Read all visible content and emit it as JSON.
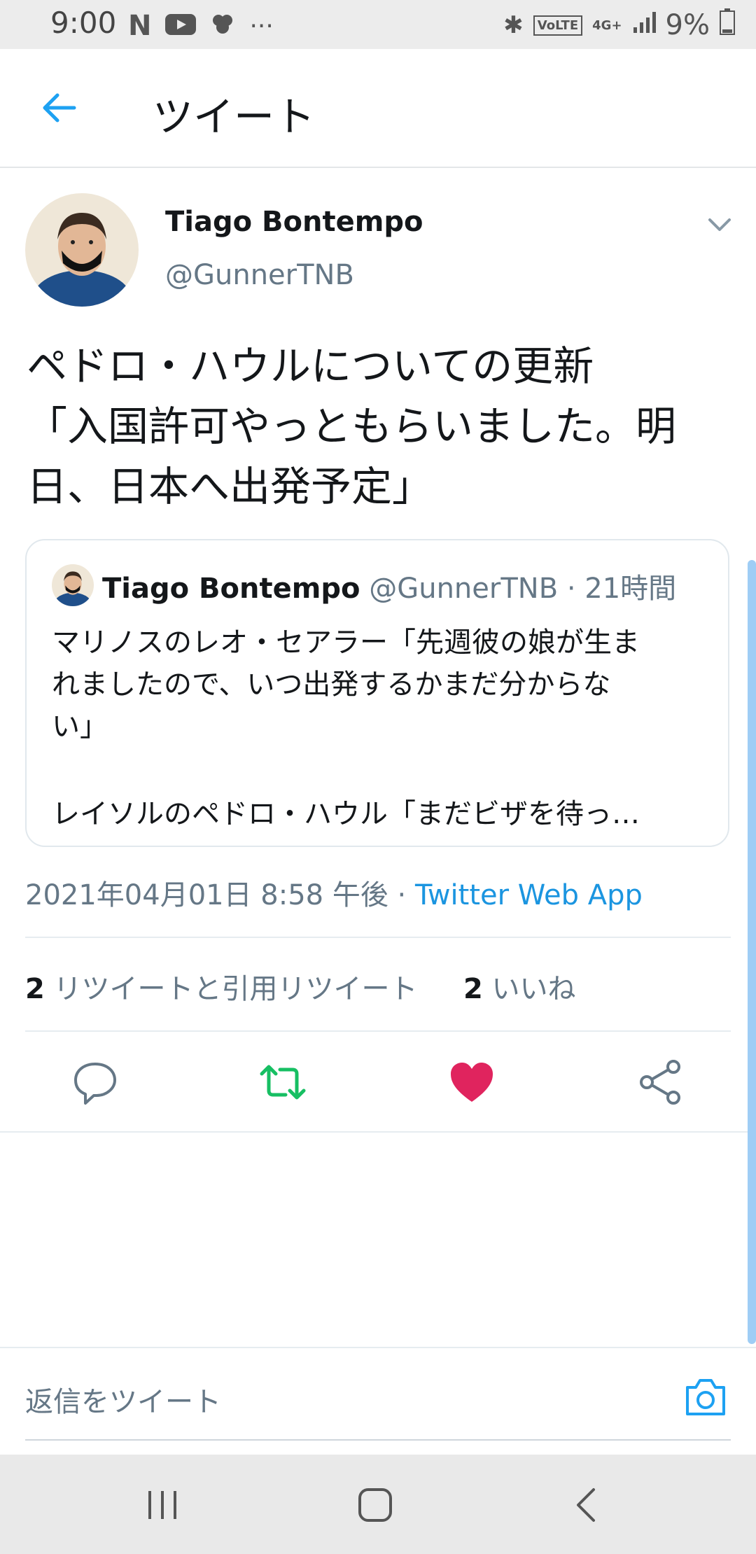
{
  "status_bar": {
    "time": "9:00",
    "left_icons": [
      "netflix-icon",
      "youtube-icon",
      "brain-icon",
      "more-dots-icon"
    ],
    "right_icons": [
      "bluetooth-icon",
      "volte-icon",
      "4g-icon",
      "signal-icon",
      "battery-icon"
    ],
    "battery": "9%"
  },
  "header": {
    "title": "ツイート"
  },
  "tweet": {
    "author_name": "Tiago Bontempo",
    "author_handle": "@GunnerTNB",
    "text_line1": "ペドロ・ハウルについての更新",
    "text_line2": "「入国許可やっともらいました。明",
    "text_line3": "日、日本へ出発予定」",
    "timestamp": "2021年04月01日 8:58 午後 · ",
    "source_app": "Twitter Web App",
    "retweet_count": "2",
    "retweet_label": " リツイートと引用リツイート",
    "like_count": "2",
    "like_label": " いいね"
  },
  "quoted_tweet": {
    "author_name": "Tiago Bontempo",
    "meta": " @GunnerTNB · 21時間",
    "text_line1": "マリノスのレオ・セアラー「先週彼の娘が生ま",
    "text_line2": "れましたので、いつ出発するかまだ分からな",
    "text_line3": "い」",
    "text_line4": "レイソルのペドロ・ハウル「まだビザを待っ…"
  },
  "reply": {
    "placeholder": "返信をツイート"
  },
  "colors": {
    "accent": "#1da1f2",
    "retweet_green": "#17bf63",
    "like_red": "#e0245e",
    "secondary_text": "#657786"
  }
}
